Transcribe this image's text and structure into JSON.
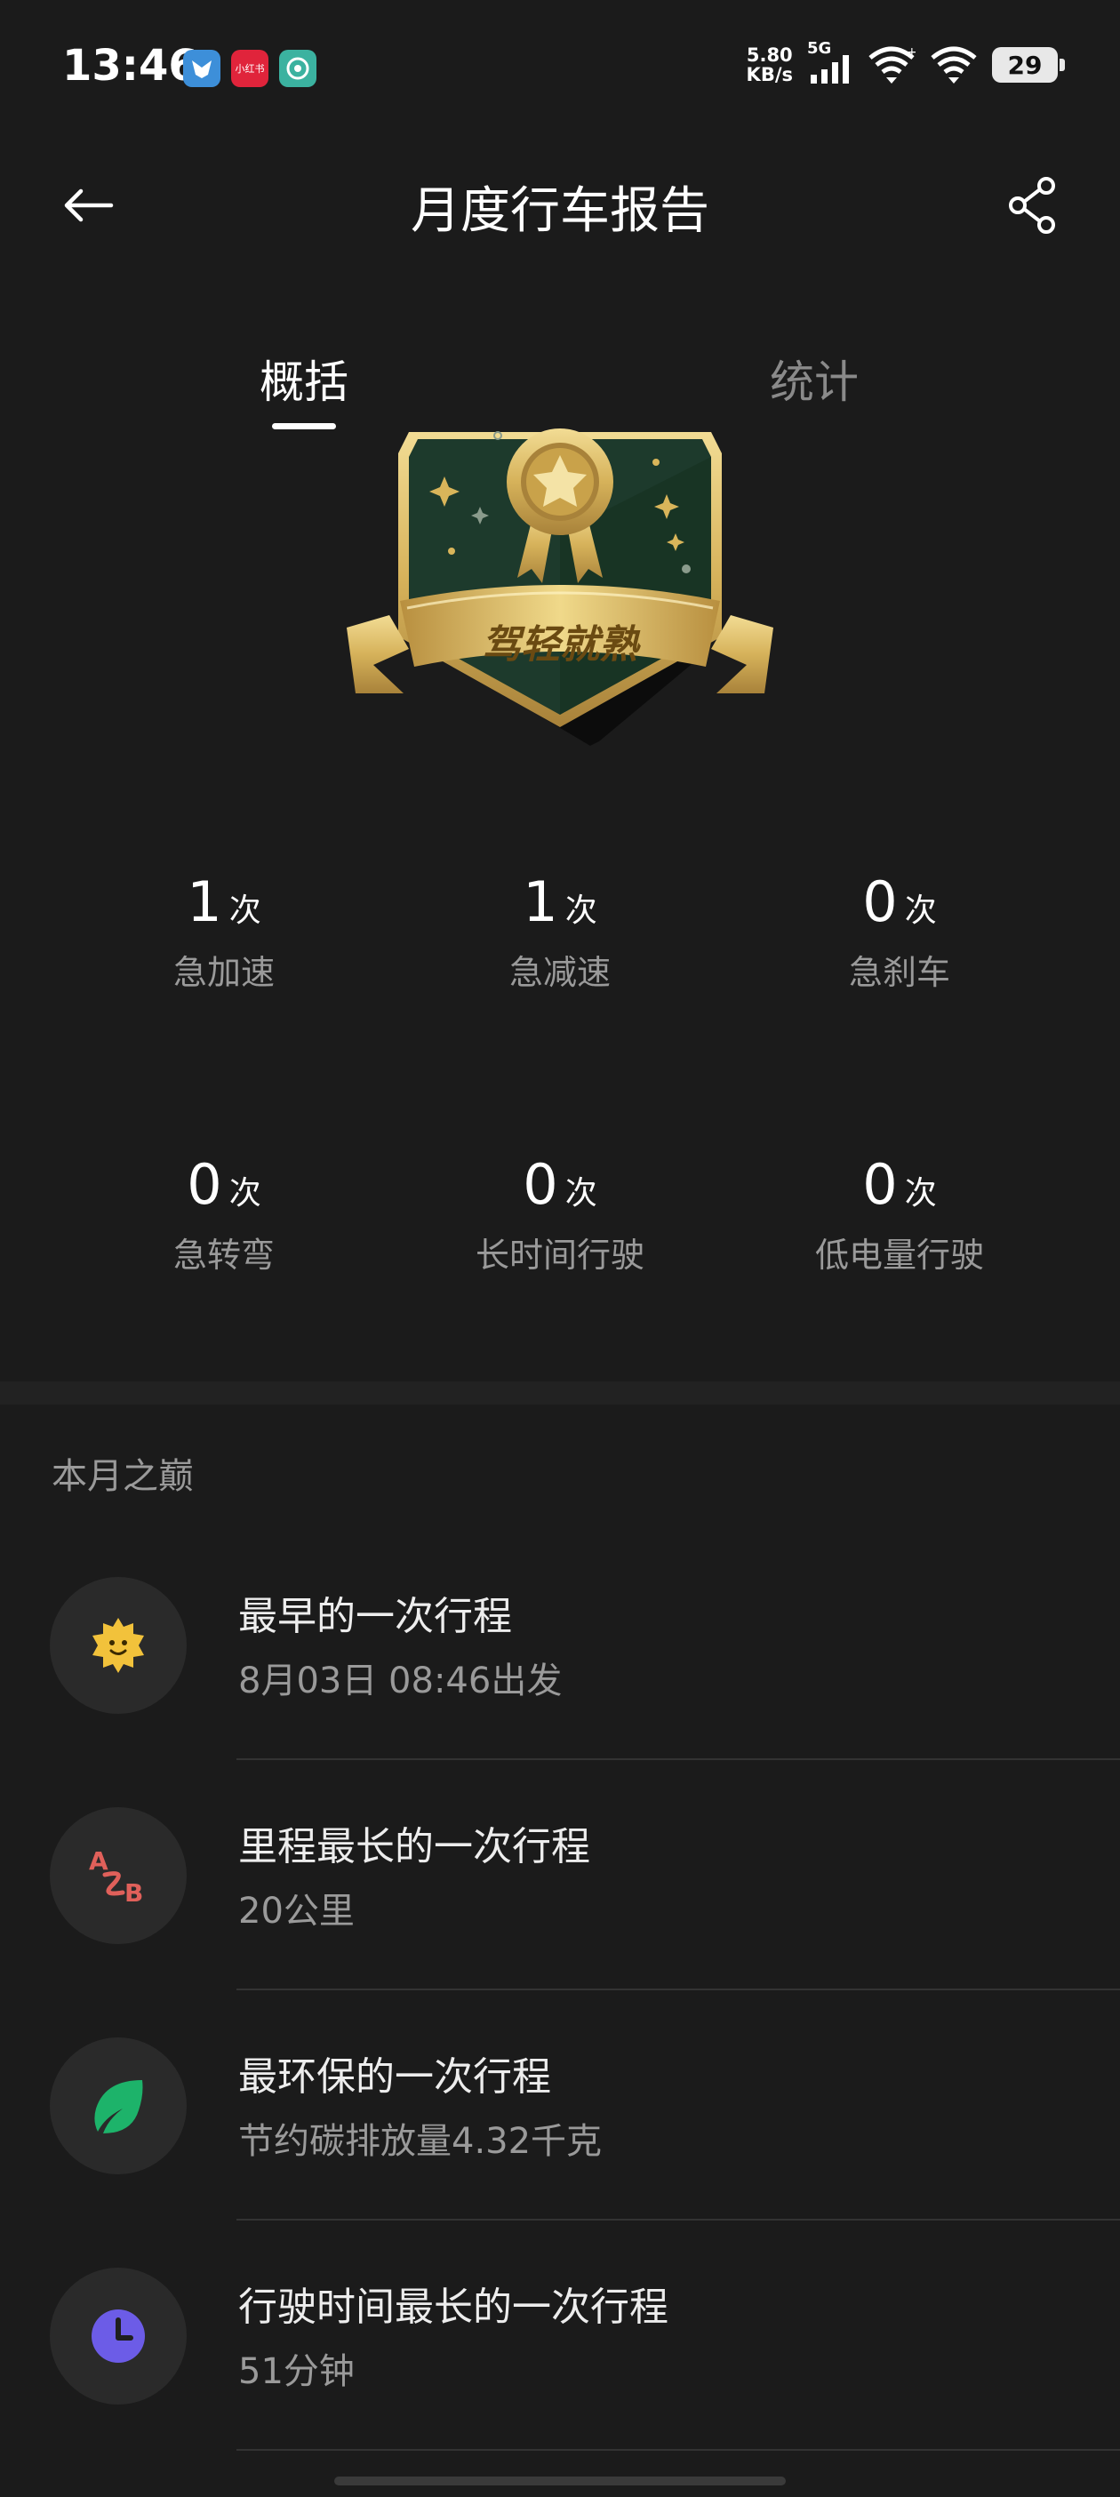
{
  "status_bar": {
    "time": "13:46",
    "app_icons": [
      {
        "name": "fox-app-icon",
        "color": "#3d8fd9",
        "label": ""
      },
      {
        "name": "xiaohongshu-app-icon",
        "color": "#e0243b",
        "label": "小红书"
      },
      {
        "name": "wifi-helper-app-icon",
        "color": "#3bb2a0",
        "label": ""
      }
    ],
    "net_speed_value": "5.80",
    "net_speed_unit": "KB/s",
    "network_type": "5G",
    "battery": "29"
  },
  "header": {
    "title": "月度行车报告"
  },
  "tabs": [
    {
      "label": "概括",
      "active": true
    },
    {
      "label": "统计",
      "active": false
    }
  ],
  "badge": {
    "text": "驾轻就熟",
    "colors": {
      "dark": "#1d3a2c",
      "gold": "#d9b55a",
      "gold_light": "#f0d98a"
    }
  },
  "stats": [
    {
      "value": "1",
      "unit": "次",
      "label": "急加速"
    },
    {
      "value": "1",
      "unit": "次",
      "label": "急减速"
    },
    {
      "value": "0",
      "unit": "次",
      "label": "急刹车"
    },
    {
      "value": "0",
      "unit": "次",
      "label": "急转弯"
    },
    {
      "value": "0",
      "unit": "次",
      "label": "长时间行驶"
    },
    {
      "value": "0",
      "unit": "次",
      "label": "低电量行驶"
    }
  ],
  "highlights": {
    "section_title": "本月之巅",
    "items": [
      {
        "title": "最早的一次行程",
        "subtitle": "8月03日 08:46出发",
        "icon": "sun-icon",
        "icon_color": "#f2c23b"
      },
      {
        "title": "里程最长的一次行程",
        "subtitle": "20公里",
        "icon": "route-a-to-b-icon",
        "icon_color": "#e0605a"
      },
      {
        "title": "最环保的一次行程",
        "subtitle": "节约碳排放量4.32千克",
        "icon": "leaf-icon",
        "icon_color": "#1db36a"
      },
      {
        "title": "行驶时间最长的一次行程",
        "subtitle": "51分钟",
        "icon": "clock-icon",
        "icon_color": "#6c5ce7"
      }
    ]
  }
}
